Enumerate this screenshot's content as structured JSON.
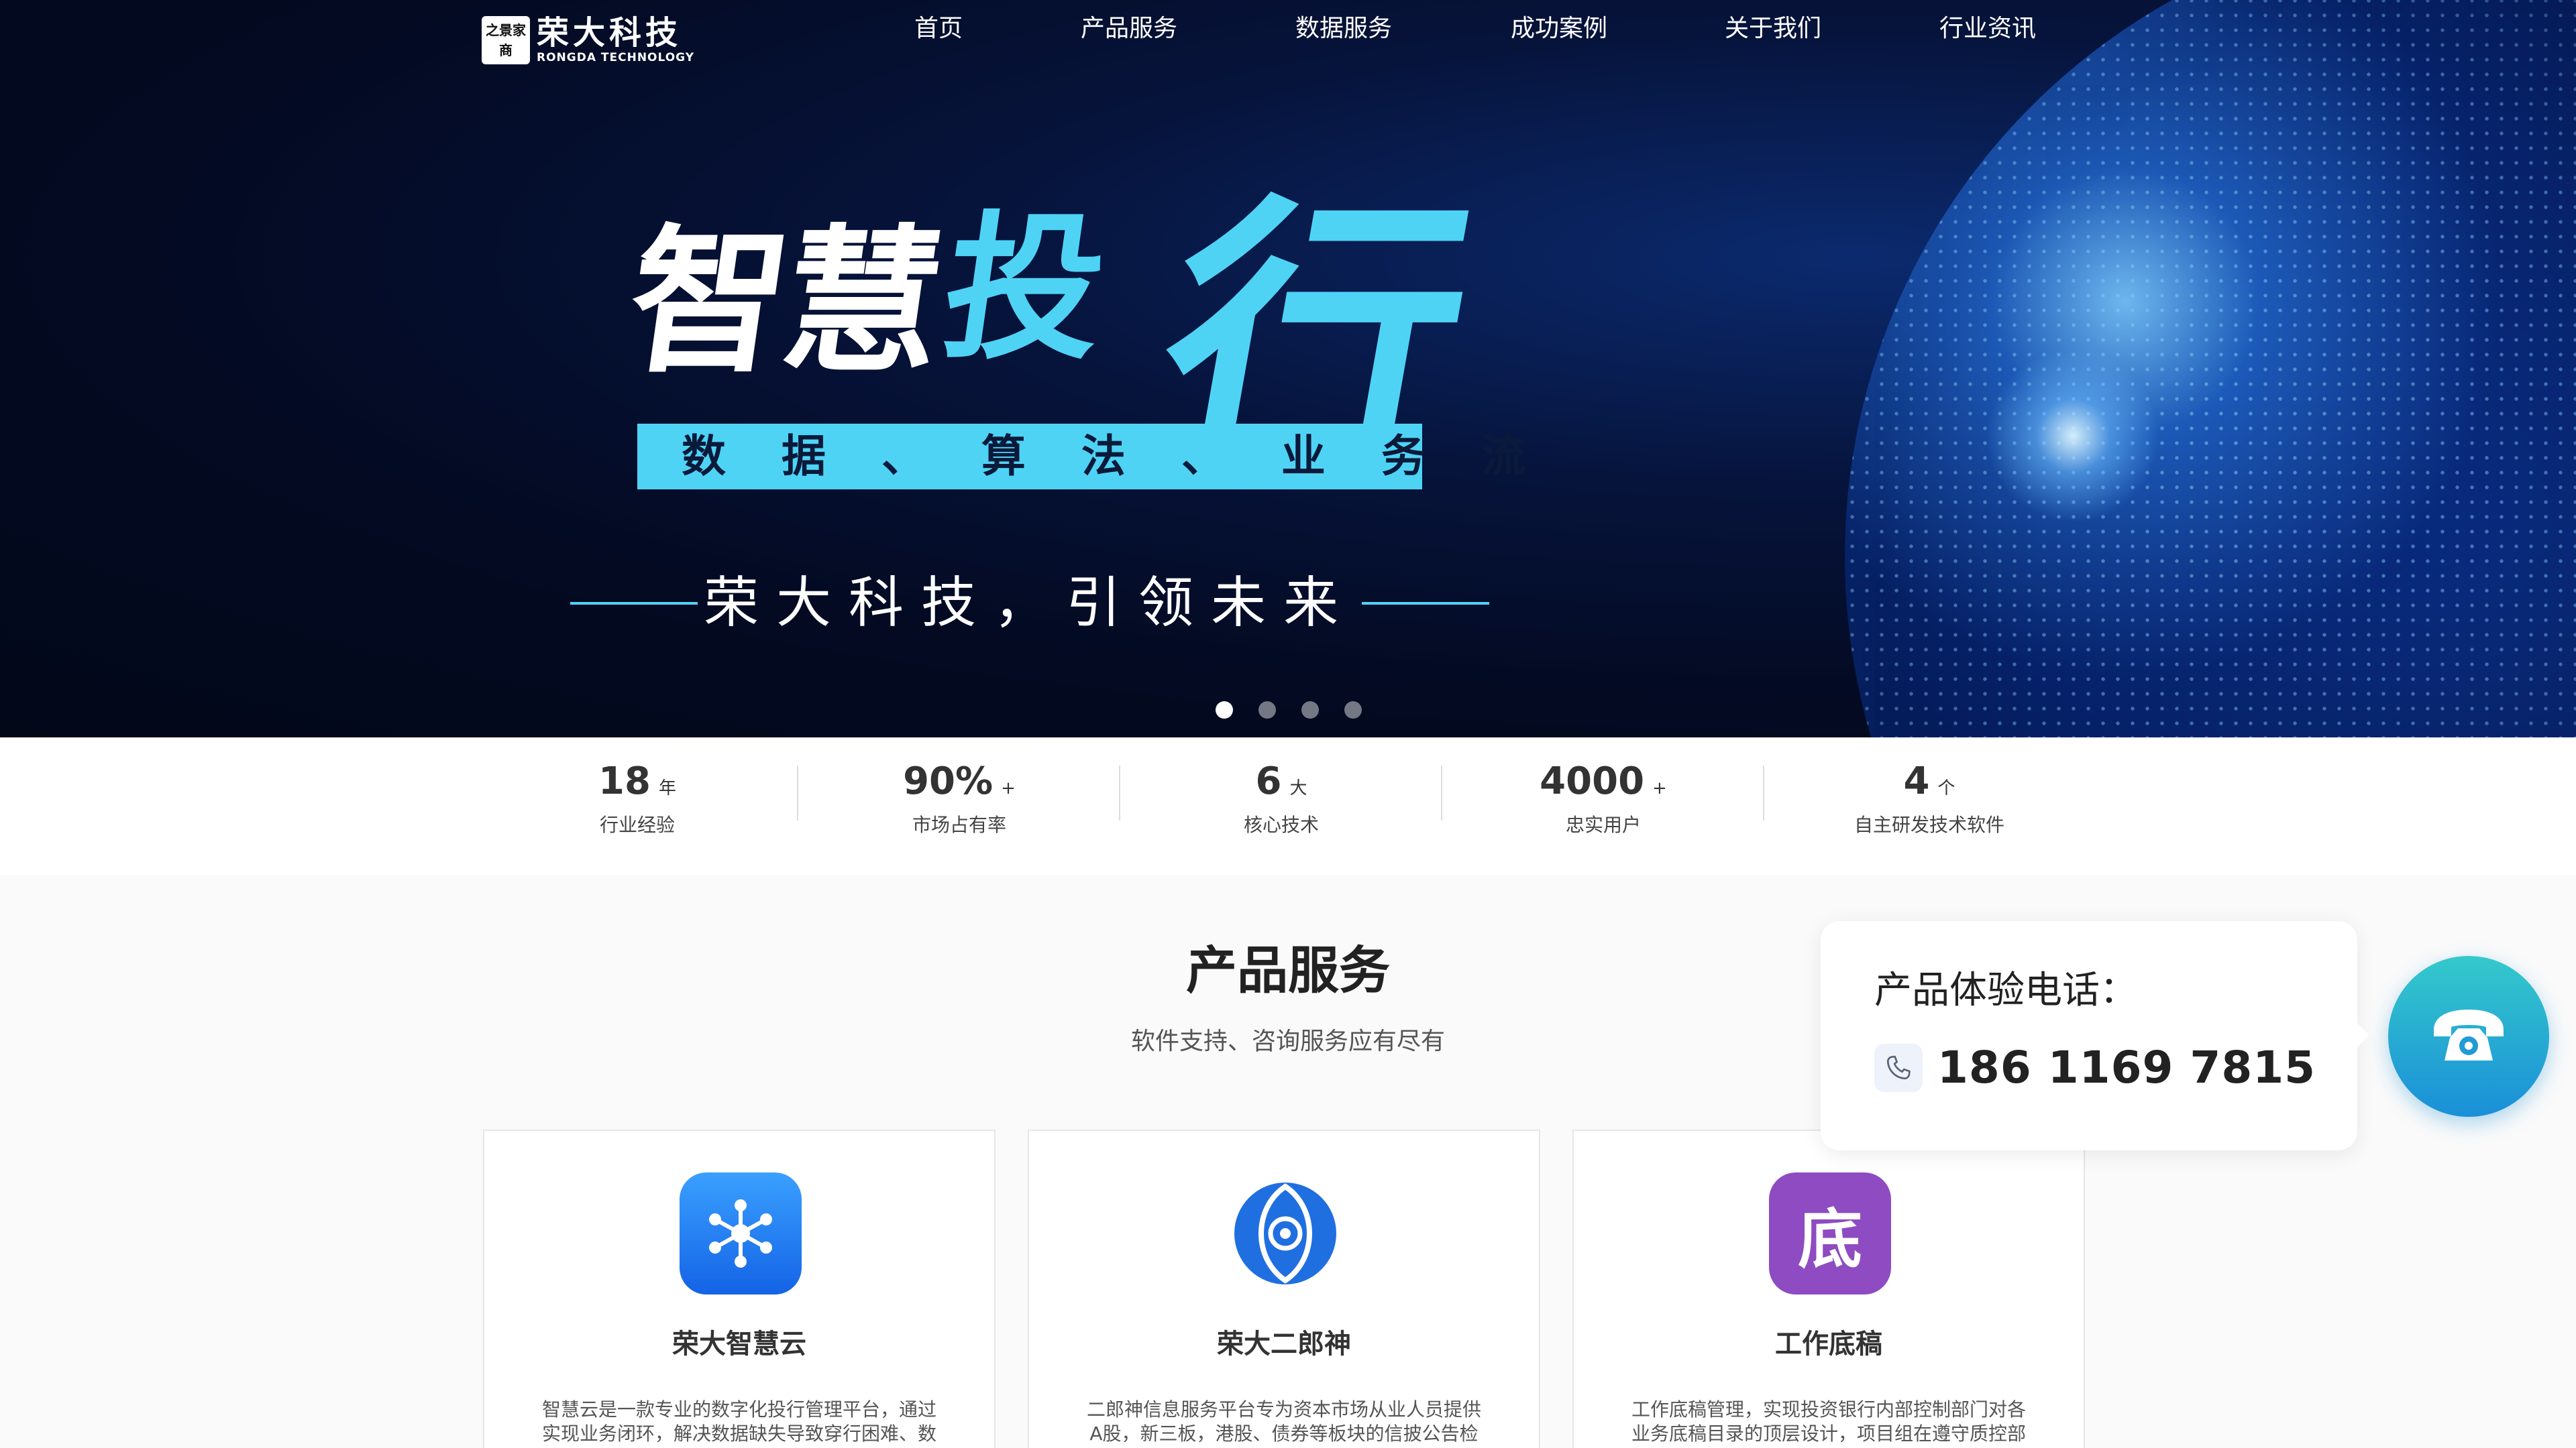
{
  "brand": {
    "mark_chars": [
      "之",
      "景",
      "家",
      "商"
    ],
    "name": "荣大科技",
    "sub": "RONGDA TECHNOLOGY",
    "colors": {
      "accent": "#4fd3f5",
      "hero_bg": "#030a22",
      "call_button": "#1a8fd8"
    }
  },
  "nav": {
    "items": [
      {
        "label": "首页"
      },
      {
        "label": "产品服务"
      },
      {
        "label": "数据服务"
      },
      {
        "label": "成功案例"
      },
      {
        "label": "关于我们"
      },
      {
        "label": "行业资讯"
      }
    ]
  },
  "hero": {
    "title_white": "智慧",
    "title_cyan_1": "投",
    "title_cyan_2": "行",
    "band": "数 据 、 算 法 、 业 务 流",
    "tagline": "荣大科技，引领未来",
    "slides": {
      "count": 4,
      "active": 0
    }
  },
  "stats": [
    {
      "value": "18",
      "unit": "年",
      "label": "行业经验"
    },
    {
      "value": "90%",
      "unit": "+",
      "label": "市场占有率"
    },
    {
      "value": "6",
      "unit": "大",
      "label": "核心技术"
    },
    {
      "value": "4000",
      "unit": "+",
      "label": "忠实用户"
    },
    {
      "value": "4",
      "unit": "个",
      "label": "自主研发技术软件"
    }
  ],
  "products": {
    "title": "产品服务",
    "subtitle": "软件支持、咨询服务应有尽有",
    "cards": [
      {
        "title": "荣大智慧云",
        "icon": "network-nodes-icon",
        "icon_color": "#1f7ff0",
        "desc": "智慧云是一款专业的数字化投行管理平台，通过实现业务闭环，解决数据缺失导致穿行困难、数"
      },
      {
        "title": "荣大二郎神",
        "icon": "eye-icon",
        "icon_color": "#1f6fe0",
        "desc": "二郎神信息服务平台专为资本市场从业人员提供A股，新三板，港股、债券等板块的信披公告检"
      },
      {
        "title": "工作底稿",
        "icon": "di-char-icon",
        "icon_color": "#8e4bc2",
        "icon_char": "底",
        "desc": "工作底稿管理，实现投资银行内部控制部门对各业务底稿目录的顶层设计，项目组在遵守质控部"
      }
    ]
  },
  "contact": {
    "label": "产品体验电话：",
    "phone": "186 1169 7815"
  }
}
